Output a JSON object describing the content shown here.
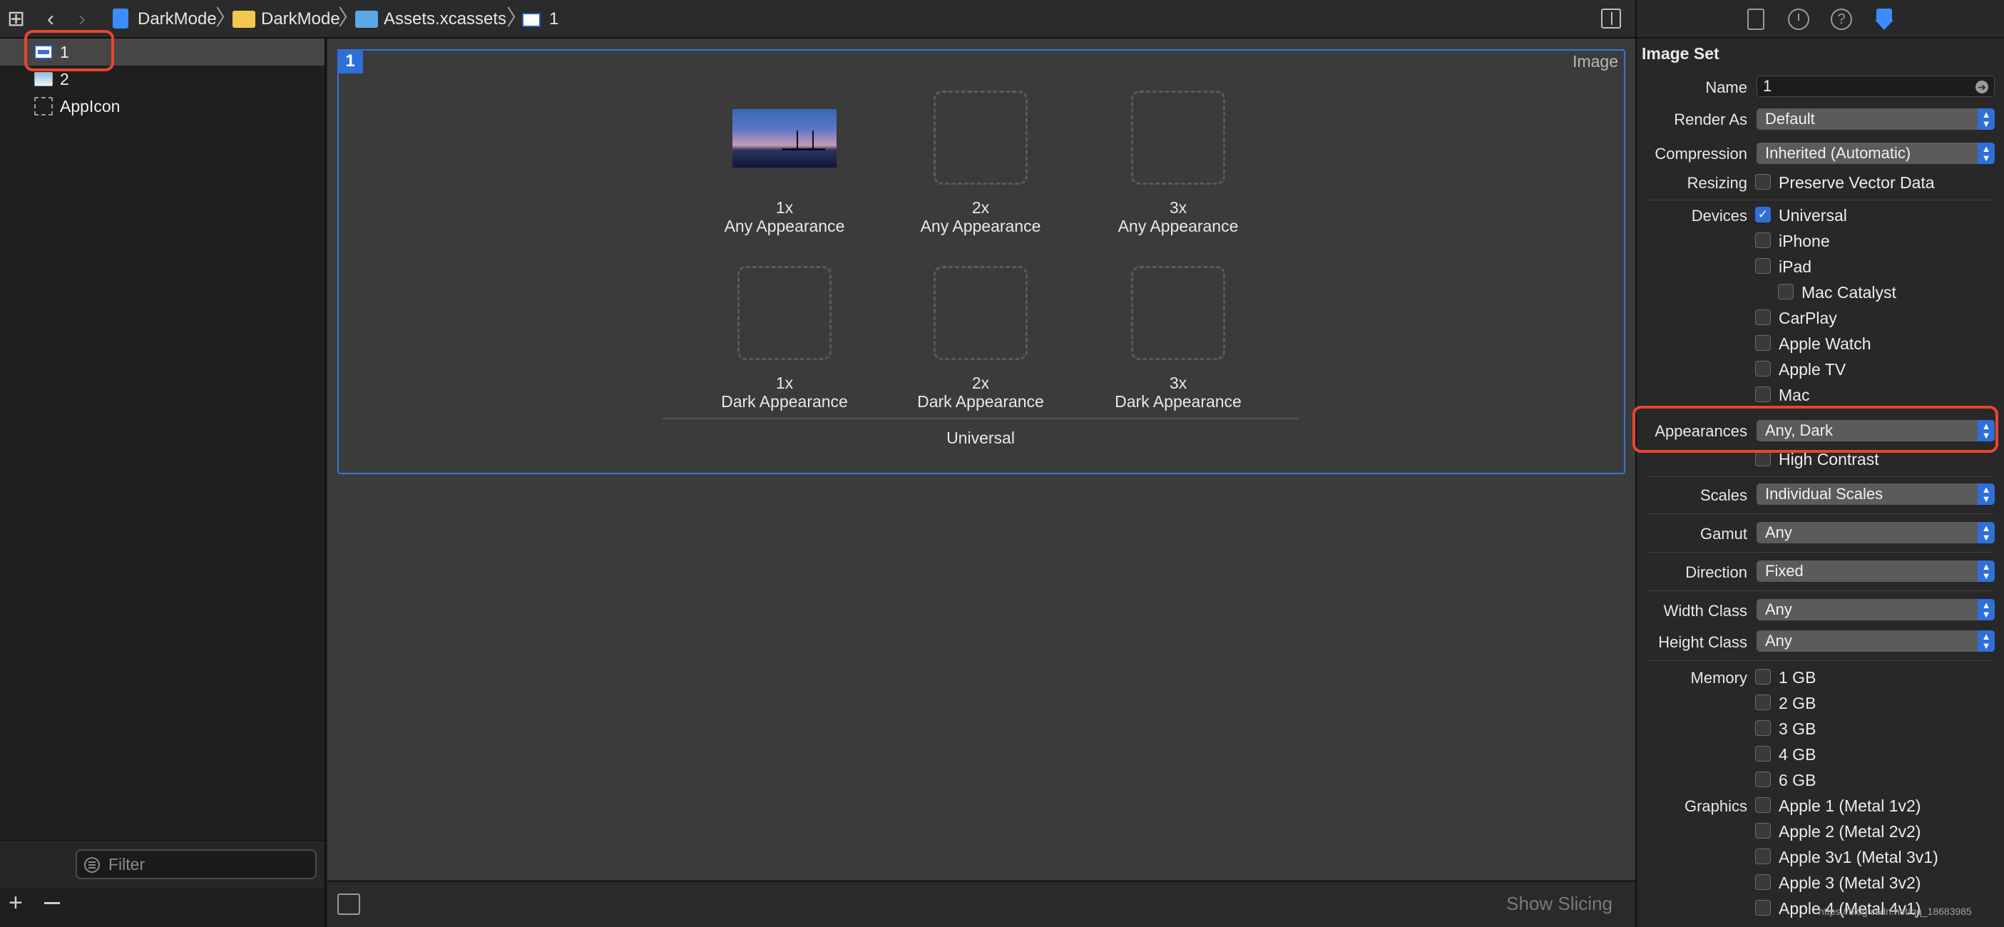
{
  "breadcrumb": {
    "items": [
      "DarkMode",
      "DarkMode",
      "Assets.xcassets",
      "1"
    ]
  },
  "navigator": {
    "items": [
      {
        "label": "1",
        "icon": "image-set-icon"
      },
      {
        "label": "2",
        "icon": "image-set-icon"
      },
      {
        "label": "AppIcon",
        "icon": "app-icon-set-icon"
      }
    ],
    "filter_placeholder": "Filter"
  },
  "editor": {
    "set_badge": "1",
    "set_type": "Image",
    "slots": [
      {
        "scale": "1x",
        "appearance": "Any Appearance",
        "filled": true
      },
      {
        "scale": "2x",
        "appearance": "Any Appearance",
        "filled": false
      },
      {
        "scale": "3x",
        "appearance": "Any Appearance",
        "filled": false
      },
      {
        "scale": "1x",
        "appearance": "Dark Appearance",
        "filled": false
      },
      {
        "scale": "2x",
        "appearance": "Dark Appearance",
        "filled": false
      },
      {
        "scale": "3x",
        "appearance": "Dark Appearance",
        "filled": false
      }
    ],
    "group_label": "Universal",
    "show_slicing": "Show Slicing"
  },
  "inspector": {
    "title": "Image Set",
    "name_label": "Name",
    "name_value": "1",
    "render_as_label": "Render As",
    "render_as_value": "Default",
    "compression_label": "Compression",
    "compression_value": "Inherited (Automatic)",
    "resizing_label": "Resizing",
    "preserve_vector": "Preserve Vector Data",
    "devices_label": "Devices",
    "devices": [
      {
        "label": "Universal",
        "checked": true
      },
      {
        "label": "iPhone",
        "checked": false
      },
      {
        "label": "iPad",
        "checked": false
      },
      {
        "label": "Mac Catalyst",
        "checked": false
      },
      {
        "label": "CarPlay",
        "checked": false
      },
      {
        "label": "Apple Watch",
        "checked": false
      },
      {
        "label": "Apple TV",
        "checked": false
      },
      {
        "label": "Mac",
        "checked": false
      }
    ],
    "appearances_label": "Appearances",
    "appearances_value": "Any, Dark",
    "high_contrast": "High Contrast",
    "scales_label": "Scales",
    "scales_value": "Individual Scales",
    "gamut_label": "Gamut",
    "gamut_value": "Any",
    "direction_label": "Direction",
    "direction_value": "Fixed",
    "width_class_label": "Width Class",
    "width_class_value": "Any",
    "height_class_label": "Height Class",
    "height_class_value": "Any",
    "memory_label": "Memory",
    "memory": [
      "1 GB",
      "2 GB",
      "3 GB",
      "4 GB",
      "6 GB"
    ],
    "graphics_label": "Graphics",
    "graphics": [
      "Apple 1 (Metal 1v2)",
      "Apple 2 (Metal 2v2)",
      "Apple 3v1 (Metal 3v1)",
      "Apple 3 (Metal 3v2)",
      "Apple 4 (Metal 4v1)"
    ]
  },
  "watermark": "https://blog.csdn.net/qq_18683985",
  "colors": {
    "accent": "#2f6fd8",
    "highlight": "#e8452f",
    "panel_bg": "#282828",
    "editor_bg": "#3b3b3b"
  }
}
